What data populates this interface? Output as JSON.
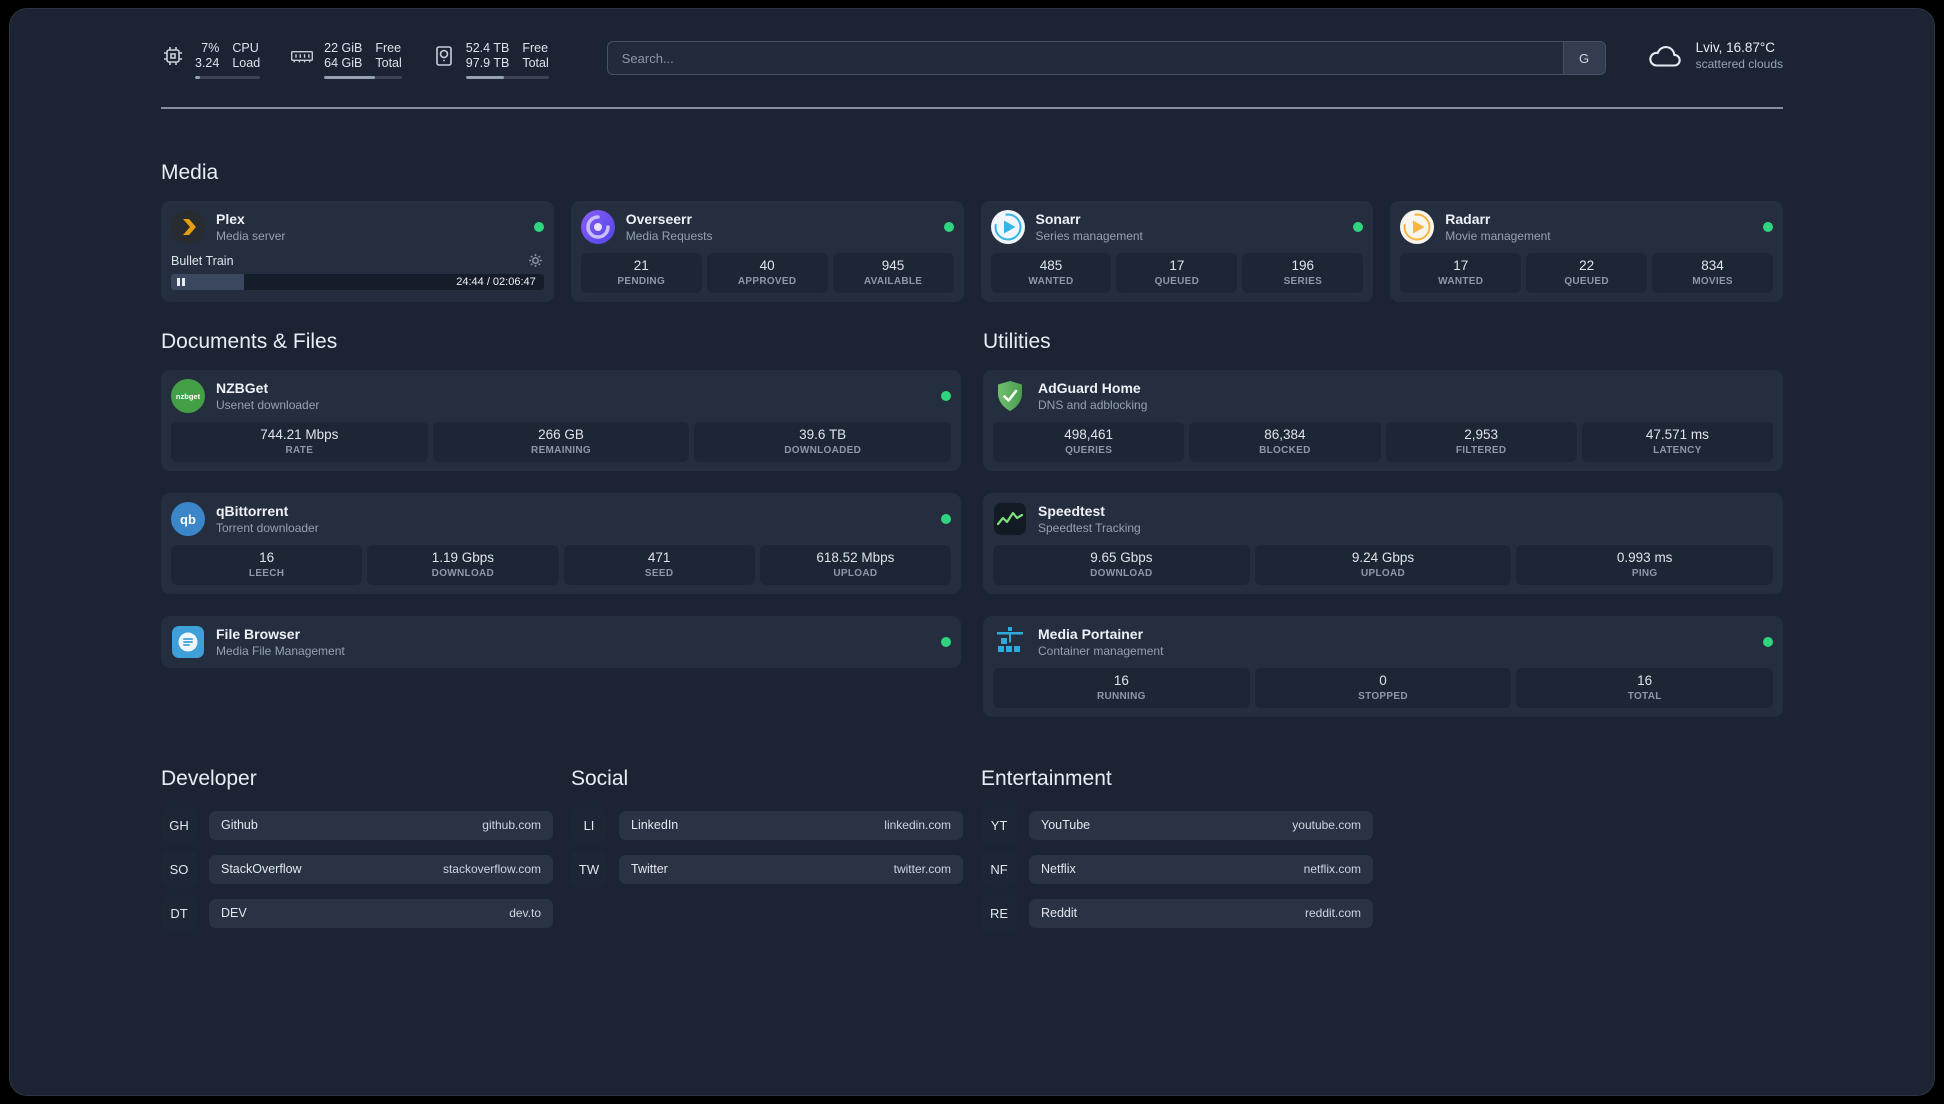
{
  "colors": {
    "status_online": "#2fd57e",
    "plex_accent": "#e5a00d",
    "sonarr_accent": "#35b4e5",
    "radarr_accent": "#f9b53e",
    "adguard_accent": "#5fae62",
    "portainer_accent": "#2eaadc"
  },
  "topbar": {
    "resources": [
      {
        "icon": "cpu-icon",
        "rows": [
          [
            "7%",
            "CPU"
          ],
          [
            "3.24",
            "Load"
          ]
        ],
        "bar_percent": 7
      },
      {
        "icon": "memory-icon",
        "rows": [
          [
            "22 GiB",
            "Free"
          ],
          [
            "64 GiB",
            "Total"
          ]
        ],
        "bar_percent": 66
      },
      {
        "icon": "disk-icon",
        "rows": [
          [
            "52.4 TB",
            "Free"
          ],
          [
            "97.9 TB",
            "Total"
          ]
        ],
        "bar_percent": 46
      }
    ],
    "search": {
      "placeholder": "Search...",
      "button": "G"
    },
    "weather": {
      "location": "Lviv, 16.87°C",
      "condition": "scattered clouds"
    }
  },
  "sections": {
    "media": {
      "title": "Media",
      "services": [
        {
          "name": "Plex",
          "description": "Media server",
          "online": true,
          "player": {
            "track": "Bullet Train",
            "time": "24:44 / 02:06:47",
            "progress_percent": 19.5
          }
        },
        {
          "name": "Overseerr",
          "description": "Media Requests",
          "online": true,
          "stats": [
            {
              "value": "21",
              "label": "PENDING"
            },
            {
              "value": "40",
              "label": "APPROVED"
            },
            {
              "value": "945",
              "label": "AVAILABLE"
            }
          ]
        },
        {
          "name": "Sonarr",
          "description": "Series management",
          "online": true,
          "stats": [
            {
              "value": "485",
              "label": "WANTED"
            },
            {
              "value": "17",
              "label": "QUEUED"
            },
            {
              "value": "196",
              "label": "SERIES"
            }
          ]
        },
        {
          "name": "Radarr",
          "description": "Movie management",
          "online": true,
          "stats": [
            {
              "value": "17",
              "label": "WANTED"
            },
            {
              "value": "22",
              "label": "QUEUED"
            },
            {
              "value": "834",
              "label": "MOVIES"
            }
          ]
        }
      ]
    },
    "documents": {
      "title": "Documents & Files",
      "services": [
        {
          "name": "NZBGet",
          "description": "Usenet downloader",
          "online": true,
          "icon_text": "nzbget",
          "stats": [
            {
              "value": "744.21 Mbps",
              "label": "RATE"
            },
            {
              "value": "266 GB",
              "label": "REMAINING"
            },
            {
              "value": "39.6 TB",
              "label": "DOWNLOADED"
            }
          ]
        },
        {
          "name": "qBittorrent",
          "description": "Torrent downloader",
          "online": true,
          "icon_text": "qb",
          "stats": [
            {
              "value": "16",
              "label": "LEECH"
            },
            {
              "value": "1.19 Gbps",
              "label": "DOWNLOAD"
            },
            {
              "value": "471",
              "label": "SEED"
            },
            {
              "value": "618.52 Mbps",
              "label": "UPLOAD"
            }
          ]
        },
        {
          "name": "File Browser",
          "description": "Media File Management",
          "online": true
        }
      ]
    },
    "utilities": {
      "title": "Utilities",
      "services": [
        {
          "name": "AdGuard Home",
          "description": "DNS and adblocking",
          "stats": [
            {
              "value": "498,461",
              "label": "QUERIES"
            },
            {
              "value": "86,384",
              "label": "BLOCKED"
            },
            {
              "value": "2,953",
              "label": "FILTERED"
            },
            {
              "value": "47.571 ms",
              "label": "LATENCY"
            }
          ]
        },
        {
          "name": "Speedtest",
          "description": "Speedtest Tracking",
          "stats": [
            {
              "value": "9.65 Gbps",
              "label": "DOWNLOAD"
            },
            {
              "value": "9.24 Gbps",
              "label": "UPLOAD"
            },
            {
              "value": "0.993 ms",
              "label": "PING"
            }
          ]
        },
        {
          "name": "Media Portainer",
          "description": "Container management",
          "online": true,
          "stats": [
            {
              "value": "16",
              "label": "RUNNING"
            },
            {
              "value": "0",
              "label": "STOPPED"
            },
            {
              "value": "16",
              "label": "TOTAL"
            }
          ]
        }
      ]
    }
  },
  "bookmarks": [
    {
      "title": "Developer",
      "items": [
        {
          "abbr": "GH",
          "name": "Github",
          "url": "github.com"
        },
        {
          "abbr": "SO",
          "name": "StackOverflow",
          "url": "stackoverflow.com"
        },
        {
          "abbr": "DT",
          "name": "DEV",
          "url": "dev.to"
        }
      ]
    },
    {
      "title": "Social",
      "items": [
        {
          "abbr": "LI",
          "name": "LinkedIn",
          "url": "linkedin.com"
        },
        {
          "abbr": "TW",
          "name": "Twitter",
          "url": "twitter.com"
        }
      ]
    },
    {
      "title": "Entertainment",
      "items": [
        {
          "abbr": "YT",
          "name": "YouTube",
          "url": "youtube.com"
        },
        {
          "abbr": "NF",
          "name": "Netflix",
          "url": "netflix.com"
        },
        {
          "abbr": "RE",
          "name": "Reddit",
          "url": "reddit.com"
        }
      ]
    }
  ]
}
